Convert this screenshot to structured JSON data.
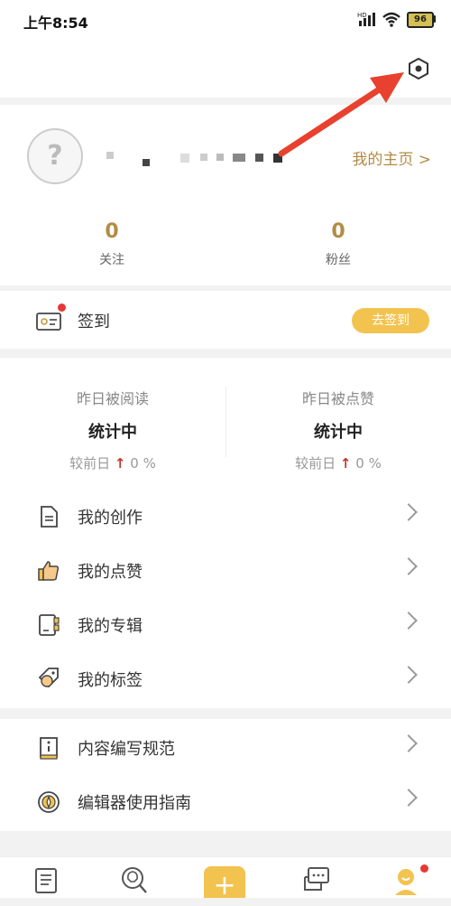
{
  "status_bar": {
    "time": "上午8:54",
    "battery": "96"
  },
  "profile": {
    "homepage_link": "我的主页 >"
  },
  "stats": [
    {
      "value": "0",
      "label": "关注"
    },
    {
      "value": "0",
      "label": "粉丝"
    }
  ],
  "checkin": {
    "label": "签到",
    "button": "去签到"
  },
  "read_stats": [
    {
      "title": "昨日被阅读",
      "value": "统计中",
      "compare_prefix": "较前日",
      "compare_value": "0 %"
    },
    {
      "title": "昨日被点赞",
      "value": "统计中",
      "compare_prefix": "较前日",
      "compare_value": "0 %"
    }
  ],
  "menu": [
    {
      "label": "我的创作",
      "icon": "document-icon"
    },
    {
      "label": "我的点赞",
      "icon": "thumbs-up-icon"
    },
    {
      "label": "我的专辑",
      "icon": "album-icon"
    },
    {
      "label": "我的标签",
      "icon": "tag-icon"
    }
  ],
  "menu2": [
    {
      "label": "内容编写规范",
      "icon": "info-book-icon"
    },
    {
      "label": "编辑器使用指南",
      "icon": "compass-icon"
    }
  ],
  "tabs": [
    {
      "icon": "article-tab-icon"
    },
    {
      "icon": "discover-tab-icon"
    },
    {
      "icon": "create-plus-icon",
      "label": "+"
    },
    {
      "icon": "messages-tab-icon"
    },
    {
      "icon": "profile-tab-icon"
    }
  ],
  "colors": {
    "accent": "#b38b45",
    "button": "#f3c350",
    "arrow": "#e8412f",
    "badge": "#e53935"
  }
}
